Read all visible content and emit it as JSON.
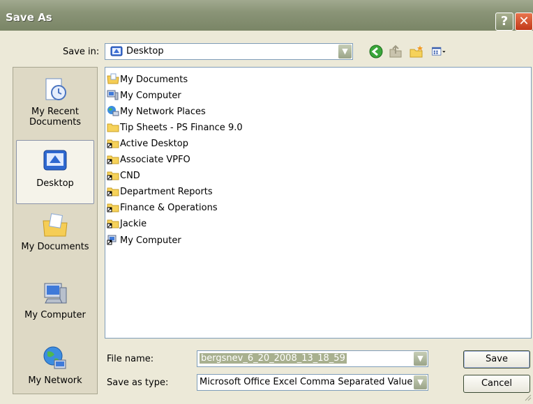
{
  "window": {
    "title": "Save As"
  },
  "save_in": {
    "label": "Save in:",
    "value": "Desktop"
  },
  "places": [
    {
      "label": "My Recent Documents"
    },
    {
      "label": "Desktop"
    },
    {
      "label": "My Documents"
    },
    {
      "label": "My Computer"
    },
    {
      "label": "My Network"
    }
  ],
  "files": [
    {
      "name": "My Documents",
      "icon": "my-documents-icon"
    },
    {
      "name": "My Computer",
      "icon": "my-computer-icon"
    },
    {
      "name": "My Network Places",
      "icon": "network-places-icon"
    },
    {
      "name": "Tip Sheets - PS Finance 9.0",
      "icon": "folder-icon"
    },
    {
      "name": "Active Desktop",
      "icon": "folder-shortcut-icon"
    },
    {
      "name": "Associate VPFO",
      "icon": "folder-shortcut-icon"
    },
    {
      "name": "CND",
      "icon": "folder-shortcut-icon"
    },
    {
      "name": "Department Reports",
      "icon": "folder-shortcut-icon"
    },
    {
      "name": "Finance & Operations",
      "icon": "folder-shortcut-icon"
    },
    {
      "name": "Jackie",
      "icon": "folder-shortcut-icon"
    },
    {
      "name": "My Computer",
      "icon": "computer-shortcut-icon"
    }
  ],
  "file_name": {
    "label": "File name:",
    "value": "bergsnev_6_20_2008_13_18_59"
  },
  "save_as_type": {
    "label": "Save as type:",
    "value": "Microsoft Office Excel Comma Separated Values"
  },
  "buttons": {
    "save": "Save",
    "cancel": "Cancel"
  }
}
